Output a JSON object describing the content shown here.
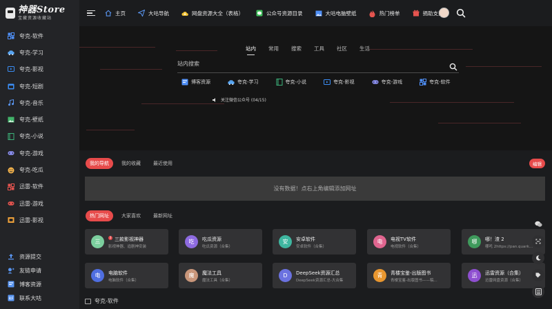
{
  "brand": {
    "title": "神器Store",
    "subtitle": "宝藏资源收藏站"
  },
  "sidebar": {
    "items": [
      {
        "label": "夸克-软件",
        "icon": "grid-icon",
        "color": "#4f8ff7"
      },
      {
        "label": "夸克-学习",
        "icon": "car-icon",
        "color": "#5aa9f8"
      },
      {
        "label": "夸克-影视",
        "icon": "tv-icon",
        "color": "#3b8ef6"
      },
      {
        "label": "夸克-短剧",
        "icon": "calendar-icon",
        "color": "#3b8ef6"
      },
      {
        "label": "夸克-音乐",
        "icon": "music-icon",
        "color": "#5a96f2"
      },
      {
        "label": "夸克-壁纸",
        "icon": "image-icon",
        "color": "#42b36a"
      },
      {
        "label": "夸克-小说",
        "icon": "book-icon",
        "color": "#3cb37a"
      },
      {
        "label": "夸克-游戏",
        "icon": "gamepad-icon",
        "color": "#8b8ff0"
      },
      {
        "label": "夸克-吃瓜",
        "icon": "emoji-icon",
        "color": "#f2b14a"
      },
      {
        "label": "迅雷-软件",
        "icon": "apps-icon",
        "color": "#e5544f"
      },
      {
        "label": "迅雷-游戏",
        "icon": "gamepad-icon",
        "color": "#e5544f"
      },
      {
        "label": "迅雷-影视",
        "icon": "film-icon",
        "color": "#f0a23a"
      }
    ],
    "bottom": [
      {
        "label": "资源提交",
        "icon": "upload-icon",
        "color": "#5a96f2"
      },
      {
        "label": "友链申请",
        "icon": "link-icon",
        "color": "#5a96f2"
      },
      {
        "label": "博客资源",
        "icon": "blog-icon",
        "color": "#5a96f2"
      },
      {
        "label": "联系大咕",
        "icon": "contact-icon",
        "color": "#5a96f2"
      }
    ]
  },
  "header": {
    "links": [
      {
        "label": "主页",
        "icon": "home-icon",
        "color": "#5a96f2"
      },
      {
        "label": "大咕导航",
        "icon": "send-icon",
        "color": "#5a96f2"
      },
      {
        "label": "网盘资源大全（表格）",
        "icon": "cloud-icon",
        "color": "#f2c232"
      },
      {
        "label": "公众号资源目录",
        "icon": "wechat-icon",
        "color": "#3fbf5a"
      },
      {
        "label": "大咕电脑壁纸",
        "icon": "picture-icon",
        "color": "#4f8ff7"
      },
      {
        "label": "热门榜单",
        "icon": "fire-icon",
        "color": "#e5544f"
      },
      {
        "label": "捐助支持",
        "icon": "gift-icon",
        "color": "#e5544f"
      }
    ]
  },
  "search": {
    "tabs": [
      "站内",
      "常用",
      "搜索",
      "工具",
      "社区",
      "生活"
    ],
    "active_tab": "站内",
    "placeholder": "站内搜索",
    "engines": [
      {
        "label": "博客资源",
        "icon": "blog-icon",
        "color": "#4f8ff7"
      },
      {
        "label": "夸克-学习",
        "icon": "car-icon",
        "color": "#5aa9f8"
      },
      {
        "label": "夸克-小说",
        "icon": "book-icon",
        "color": "#3cb37a"
      },
      {
        "label": "夸克-影视",
        "icon": "tv-icon",
        "color": "#3b8ef6"
      },
      {
        "label": "夸克-游戏",
        "icon": "gamepad-icon",
        "color": "#8b8ff0"
      },
      {
        "label": "夸克-软件",
        "icon": "grid-icon",
        "color": "#4f8ff7"
      }
    ],
    "notice": "关注微信公众号 (04/15)"
  },
  "mynav": {
    "tabs": [
      "我的导航",
      "我的收藏",
      "最近使用"
    ],
    "edit_label": "编辑",
    "empty_text": "没有数据！点右上角编辑添加网址"
  },
  "hot": {
    "tabs": [
      "热门网址",
      "大家喜欢",
      "最新网址"
    ],
    "cards": [
      {
        "title": "三款影视神器",
        "desc": "影视神器、追剧神安装",
        "avatar": "三",
        "color": "#7ccf9e",
        "badge": "3"
      },
      {
        "title": "吃瓜资源",
        "desc": "吃瓜资源（合集）",
        "avatar": "吃",
        "color": "#8e6be0"
      },
      {
        "title": "安卓软件",
        "desc": "安卓软件（合集）",
        "avatar": "安",
        "color": "#3fb6a0"
      },
      {
        "title": "电视TV软件",
        "desc": "电视软件（合集）",
        "avatar": "电",
        "color": "#e0658f"
      },
      {
        "title": "哪！渣 2",
        "desc": "哪吒 2https://pan.quark...",
        "avatar": "哪",
        "color": "#3f9a5c"
      },
      {
        "title": "电脑软件",
        "desc": "电脑软件（合集）",
        "avatar": "电",
        "color": "#4f6ee0"
      },
      {
        "title": "魔法工具",
        "desc": "魔法工具（合集）",
        "avatar": "魔",
        "color": "#c9967a"
      },
      {
        "title": "DeepSeek资源汇总",
        "desc": "DeepSeek资源汇总-大合集",
        "avatar": "D",
        "color": "#6b72e0"
      },
      {
        "title": "青楼宝鉴-出版图书",
        "desc": "青楼宝鉴-出版图书——稿...",
        "avatar": "青",
        "color": "#e8962f"
      },
      {
        "title": "迅雷资源（合集）",
        "desc": "迅雷网盘资源（合集）",
        "avatar": "迅",
        "color": "#8e4fd0"
      }
    ]
  },
  "section": {
    "title": "夸克-软件"
  }
}
